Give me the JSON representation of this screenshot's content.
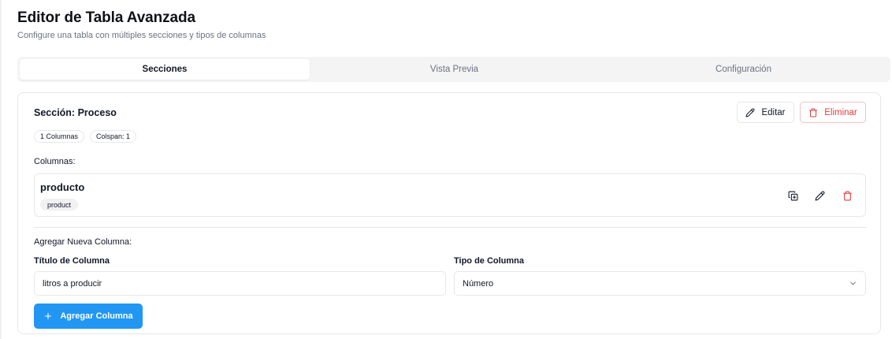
{
  "header": {
    "title": "Editor de Tabla Avanzada",
    "subtitle": "Configure una tabla con múltiples secciones y tipos de columnas"
  },
  "tabs": [
    {
      "label": "Secciones",
      "active": true
    },
    {
      "label": "Vista Previa",
      "active": false
    },
    {
      "label": "Configuración",
      "active": false
    }
  ],
  "section": {
    "title": "Sección: Proceso",
    "edit_label": "Editar",
    "delete_label": "Eliminar",
    "badges": [
      "1 Columnas",
      "Colspan: 1"
    ],
    "columns_label": "Columnas:",
    "columns": [
      {
        "name": "producto",
        "tag": "product"
      }
    ]
  },
  "add_column": {
    "heading": "Agregar Nueva Columna:",
    "title_label": "Título de Columna",
    "title_value": "litros a producir",
    "type_label": "Tipo de Columna",
    "type_value": "Número",
    "button_label": "Agregar Columna"
  },
  "colors": {
    "accent": "#2196f3",
    "danger": "#e23b3b"
  },
  "icons": {
    "edit": "pencil-icon",
    "delete": "trash-icon",
    "duplicate": "copy-icon",
    "select": "chevron-down-icon",
    "add": "plus-icon"
  }
}
